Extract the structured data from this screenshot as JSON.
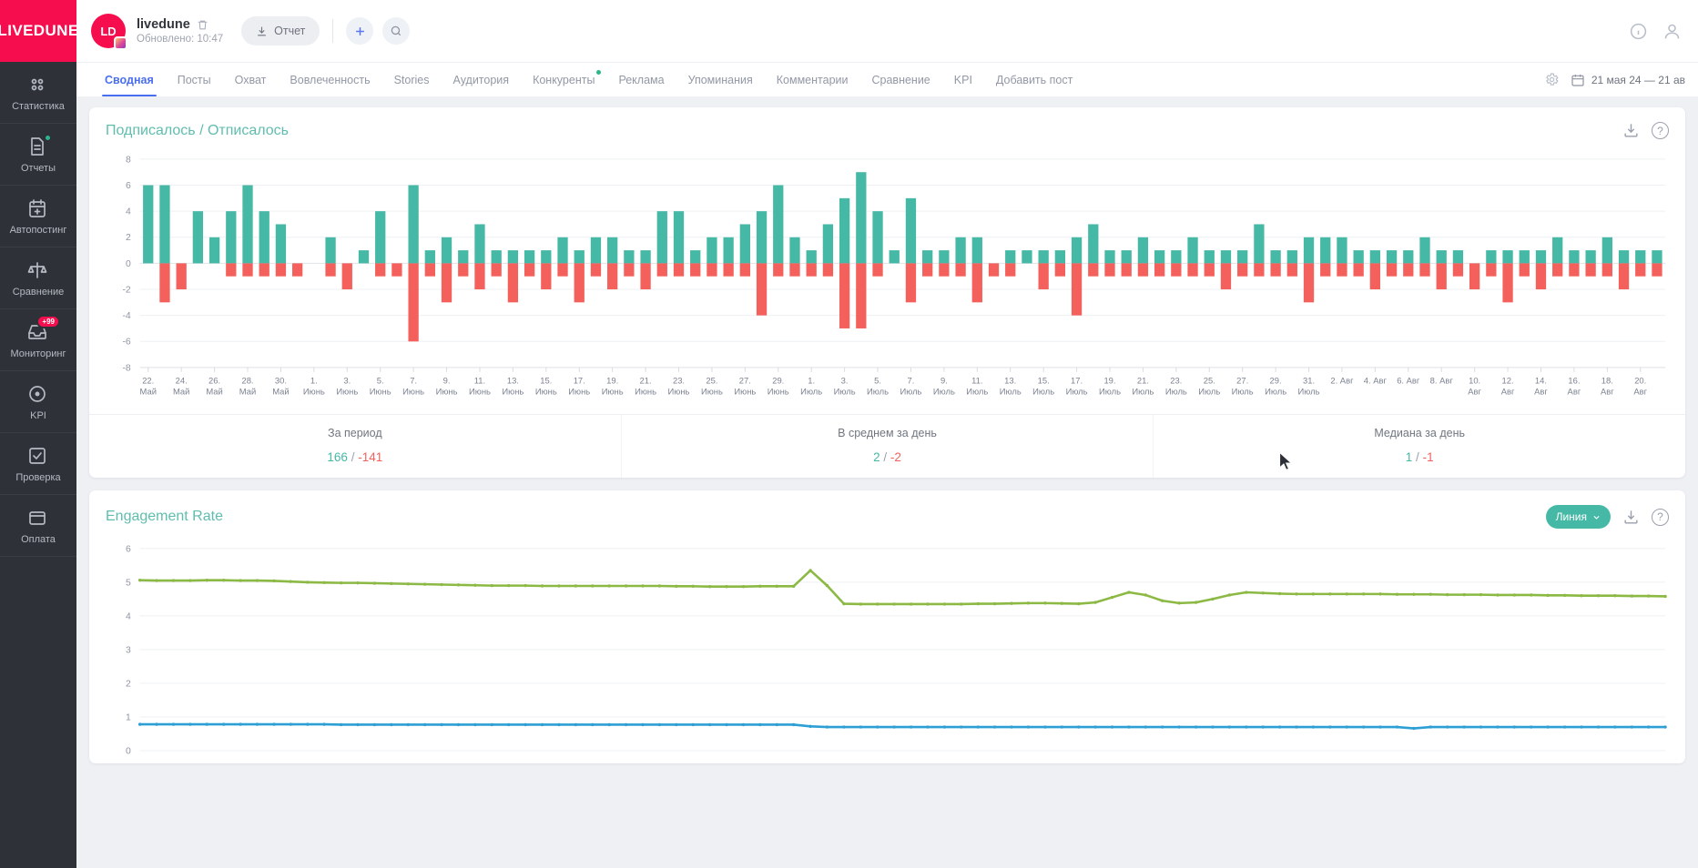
{
  "brand": {
    "logo_text": "LIVEDUNE",
    "logo_color": "#f50d4e"
  },
  "sidebar": {
    "items": [
      {
        "label": "Статистика",
        "icon": "grid-dots-icon",
        "active": false,
        "badge": null
      },
      {
        "label": "Отчеты",
        "icon": "report-doc-icon",
        "active": false,
        "badge": "dot"
      },
      {
        "label": "Автопостинг",
        "icon": "calendar-plus-icon",
        "active": false,
        "badge": null
      },
      {
        "label": "Сравнение",
        "icon": "scales-icon",
        "active": false,
        "badge": null
      },
      {
        "label": "Мониторинг",
        "icon": "inbox-icon",
        "active": false,
        "badge": "+99"
      },
      {
        "label": "KPI",
        "icon": "target-icon",
        "active": false,
        "badge": null
      },
      {
        "label": "Проверка",
        "icon": "checkbox-icon",
        "active": false,
        "badge": null
      },
      {
        "label": "Оплата",
        "icon": "wallet-icon",
        "active": false,
        "badge": null
      }
    ]
  },
  "topbar": {
    "avatar_initials": "LD",
    "account_name": "livedune",
    "updated_text": "Обновлено: 10:47",
    "report_button": "Отчет",
    "add_button_icon": "plus-icon",
    "search_button_icon": "search-icon",
    "trash_icon": "trash-icon",
    "info_icon": "info-circle-icon",
    "profile_icon": "user-icon"
  },
  "tabs": [
    {
      "label": "Сводная",
      "active": true,
      "dot": false
    },
    {
      "label": "Посты",
      "active": false,
      "dot": false
    },
    {
      "label": "Охват",
      "active": false,
      "dot": false
    },
    {
      "label": "Вовлеченность",
      "active": false,
      "dot": false
    },
    {
      "label": "Stories",
      "active": false,
      "dot": false
    },
    {
      "label": "Аудитория",
      "active": false,
      "dot": false
    },
    {
      "label": "Конкуренты",
      "active": false,
      "dot": true
    },
    {
      "label": "Реклама",
      "active": false,
      "dot": false
    },
    {
      "label": "Упоминания",
      "active": false,
      "dot": false
    },
    {
      "label": "Комментарии",
      "active": false,
      "dot": false
    },
    {
      "label": "Сравнение",
      "active": false,
      "dot": false
    },
    {
      "label": "KPI",
      "active": false,
      "dot": false
    },
    {
      "label": "Добавить пост",
      "active": false,
      "dot": false
    }
  ],
  "tabsbar_right": {
    "settings_icon": "gear-icon",
    "calendar_icon": "calendar-icon",
    "date_range": "21 мая 24 — 21 ав"
  },
  "subscribers_card": {
    "title": "Подписалось / Отписалось",
    "download_icon": "download-icon",
    "help_icon": "question-circle-icon",
    "summary": [
      {
        "label": "За период",
        "positive": "166",
        "separator": "/",
        "negative": "-141"
      },
      {
        "label": "В среднем за день",
        "positive": "2",
        "separator": "/",
        "negative": "-2"
      },
      {
        "label": "Медиана за день",
        "positive": "1",
        "separator": "/",
        "negative": "-1"
      }
    ]
  },
  "engagement_card": {
    "title": "Engagement Rate",
    "chart_type_selector": "Линия",
    "chevron_icon": "chevron-down-icon",
    "download_icon": "download-icon",
    "help_icon": "question-circle-icon"
  },
  "chart_data": [
    {
      "type": "bar",
      "title": "Подписалось / Отписалось",
      "xlabel": "",
      "ylabel": "",
      "ylim": [
        -8,
        8
      ],
      "yticks": [
        8,
        6,
        4,
        2,
        0,
        -2,
        -4,
        -6,
        -8
      ],
      "grid": true,
      "legend": "none",
      "colors": {
        "subscribed": "#46b8a6",
        "unsubscribed": "#f4605c"
      },
      "categories": [
        "22. Май",
        "23. Май",
        "24. Май",
        "25. Май",
        "26. Май",
        "27. Май",
        "28. Май",
        "29. Май",
        "30. Май",
        "31. Май",
        "1. Июнь",
        "2. Июнь",
        "3. Июнь",
        "4. Июнь",
        "5. Июнь",
        "6. Июнь",
        "7. Июнь",
        "8. Июнь",
        "9. Июнь",
        "10. Июнь",
        "11. Июнь",
        "12. Июнь",
        "13. Июнь",
        "14. Июнь",
        "15. Июнь",
        "16. Июнь",
        "17. Июнь",
        "18. Июнь",
        "19. Июнь",
        "20. Июнь",
        "21. Июнь",
        "22. Июнь",
        "23. Июнь",
        "24. Июнь",
        "25. Июнь",
        "26. Июнь",
        "27. Июнь",
        "28. Июнь",
        "29. Июнь",
        "30. Июнь",
        "1. Июль",
        "2. Июль",
        "3. Июль",
        "4. Июль",
        "5. Июль",
        "6. Июль",
        "7. Июль",
        "8. Июль",
        "9. Июль",
        "10. Июль",
        "11. Июль",
        "12. Июль",
        "13. Июль",
        "14. Июль",
        "15. Июль",
        "16. Июль",
        "17. Июль",
        "18. Июль",
        "19. Июль",
        "20. Июль",
        "21. Июль",
        "22. Июль",
        "23. Июль",
        "24. Июль",
        "25. Июль",
        "26. Июль",
        "27. Июль",
        "28. Июль",
        "29. Июль",
        "30. Июль",
        "31. Июль",
        "1. Авг",
        "2. Авг",
        "3. Авг",
        "4. Авг",
        "5. Авг",
        "6. Авг",
        "7. Авг",
        "8. Авг",
        "9. Авг",
        "10. Авг",
        "11. Авг",
        "12. Авг",
        "13. Авг",
        "14. Авг",
        "15. Авг",
        "16. Авг",
        "17. Авг",
        "18. Авг",
        "19. Авг",
        "20. Авг",
        "21. Авг"
      ],
      "axis_tick_labels": [
        {
          "index": 0,
          "top": "22.",
          "bottom": "Май"
        },
        {
          "index": 2,
          "top": "24.",
          "bottom": "Май"
        },
        {
          "index": 4,
          "top": "26.",
          "bottom": "Май"
        },
        {
          "index": 6,
          "top": "28.",
          "bottom": "Май"
        },
        {
          "index": 8,
          "top": "30.",
          "bottom": "Май"
        },
        {
          "index": 10,
          "top": "1.",
          "bottom": "Июнь"
        },
        {
          "index": 12,
          "top": "3.",
          "bottom": "Июнь"
        },
        {
          "index": 14,
          "top": "5.",
          "bottom": "Июнь"
        },
        {
          "index": 16,
          "top": "7.",
          "bottom": "Июнь"
        },
        {
          "index": 18,
          "top": "9.",
          "bottom": "Июнь"
        },
        {
          "index": 20,
          "top": "11.",
          "bottom": "Июнь"
        },
        {
          "index": 22,
          "top": "13.",
          "bottom": "Июнь"
        },
        {
          "index": 24,
          "top": "15.",
          "bottom": "Июнь"
        },
        {
          "index": 26,
          "top": "17.",
          "bottom": "Июнь"
        },
        {
          "index": 28,
          "top": "19.",
          "bottom": "Июнь"
        },
        {
          "index": 30,
          "top": "21.",
          "bottom": "Июнь"
        },
        {
          "index": 32,
          "top": "23.",
          "bottom": "Июнь"
        },
        {
          "index": 34,
          "top": "25.",
          "bottom": "Июнь"
        },
        {
          "index": 36,
          "top": "27.",
          "bottom": "Июнь"
        },
        {
          "index": 38,
          "top": "29.",
          "bottom": "Июнь"
        },
        {
          "index": 40,
          "top": "1.",
          "bottom": "Июль"
        },
        {
          "index": 42,
          "top": "3.",
          "bottom": "Июль"
        },
        {
          "index": 44,
          "top": "5.",
          "bottom": "Июль"
        },
        {
          "index": 46,
          "top": "7.",
          "bottom": "Июль"
        },
        {
          "index": 48,
          "top": "9.",
          "bottom": "Июль"
        },
        {
          "index": 50,
          "top": "11.",
          "bottom": "Июль"
        },
        {
          "index": 52,
          "top": "13.",
          "bottom": "Июль"
        },
        {
          "index": 54,
          "top": "15.",
          "bottom": "Июль"
        },
        {
          "index": 56,
          "top": "17.",
          "bottom": "Июль"
        },
        {
          "index": 58,
          "top": "19.",
          "bottom": "Июль"
        },
        {
          "index": 60,
          "top": "21.",
          "bottom": "Июль"
        },
        {
          "index": 62,
          "top": "23.",
          "bottom": "Июль"
        },
        {
          "index": 64,
          "top": "25.",
          "bottom": "Июль"
        },
        {
          "index": 66,
          "top": "27.",
          "bottom": "Июль"
        },
        {
          "index": 68,
          "top": "29.",
          "bottom": "Июль"
        },
        {
          "index": 70,
          "top": "31.",
          "bottom": "Июль"
        },
        {
          "index": 72,
          "top": "2. Авг",
          "bottom": ""
        },
        {
          "index": 74,
          "top": "4. Авг",
          "bottom": ""
        },
        {
          "index": 76,
          "top": "6. Авг",
          "bottom": ""
        },
        {
          "index": 78,
          "top": "8. Авг",
          "bottom": ""
        },
        {
          "index": 80,
          "top": "10.",
          "bottom": "Авг"
        },
        {
          "index": 82,
          "top": "12.",
          "bottom": "Авг"
        },
        {
          "index": 84,
          "top": "14.",
          "bottom": "Авг"
        },
        {
          "index": 86,
          "top": "16.",
          "bottom": "Авг"
        },
        {
          "index": 88,
          "top": "18.",
          "bottom": "Авг"
        },
        {
          "index": 90,
          "top": "20.",
          "bottom": "Авг"
        }
      ],
      "series": [
        {
          "name": "Подписалось",
          "color": "#46b8a6",
          "values": [
            6,
            6,
            0,
            4,
            2,
            4,
            6,
            4,
            3,
            0,
            0,
            2,
            0,
            1,
            4,
            0,
            6,
            1,
            2,
            1,
            3,
            1,
            1,
            1,
            1,
            2,
            1,
            2,
            2,
            1,
            1,
            4,
            4,
            1,
            2,
            2,
            3,
            4,
            6,
            2,
            1,
            3,
            5,
            7,
            4,
            1,
            5,
            1,
            1,
            2,
            2,
            0,
            1,
            1,
            1,
            1,
            2,
            3,
            1,
            1,
            2,
            1,
            1,
            2,
            1,
            1,
            1,
            3,
            1,
            1,
            2,
            2,
            2,
            1,
            1,
            1,
            1,
            2,
            1,
            1,
            0,
            1,
            1,
            1,
            1,
            2,
            1,
            1,
            2,
            1,
            1,
            1
          ]
        },
        {
          "name": "Отписалось",
          "color": "#f4605c",
          "values": [
            0,
            -3,
            -2,
            0,
            0,
            -1,
            -1,
            -1,
            -1,
            -1,
            0,
            -1,
            -2,
            0,
            -1,
            -1,
            -6,
            -1,
            -3,
            -1,
            -2,
            -1,
            -3,
            -1,
            -2,
            -1,
            -3,
            -1,
            -2,
            -1,
            -2,
            -1,
            -1,
            -1,
            -1,
            -1,
            -1,
            -4,
            -1,
            -1,
            -1,
            -1,
            -5,
            -5,
            -1,
            0,
            -3,
            -1,
            -1,
            -1,
            -3,
            -1,
            -1,
            0,
            -2,
            -1,
            -4,
            -1,
            -1,
            -1,
            -1,
            -1,
            -1,
            -1,
            -1,
            -2,
            -1,
            -1,
            -1,
            -1,
            -3,
            -1,
            -1,
            -1,
            -2,
            -1,
            -1,
            -1,
            -2,
            -1,
            -2,
            -1,
            -3,
            -1,
            -2,
            -1,
            -1,
            -1,
            -1,
            -2,
            -1,
            -1
          ]
        }
      ]
    },
    {
      "type": "line",
      "title": "Engagement Rate",
      "xlabel": "",
      "ylabel": "",
      "ylim": [
        0,
        6
      ],
      "yticks": [
        6,
        5,
        4,
        3,
        2,
        1,
        0
      ],
      "grid": true,
      "legend": "none",
      "series": [
        {
          "name": "ER (green)",
          "color": "#8cb944",
          "values": [
            5.06,
            5.05,
            5.05,
            5.05,
            5.06,
            5.06,
            5.05,
            5.05,
            5.04,
            5.02,
            5.0,
            4.99,
            4.98,
            4.98,
            4.97,
            4.96,
            4.95,
            4.94,
            4.93,
            4.92,
            4.91,
            4.9,
            4.9,
            4.9,
            4.89,
            4.89,
            4.89,
            4.89,
            4.89,
            4.89,
            4.89,
            4.89,
            4.88,
            4.88,
            4.87,
            4.87,
            4.87,
            4.88,
            4.88,
            4.88,
            5.35,
            4.9,
            4.36,
            4.35,
            4.35,
            4.35,
            4.35,
            4.35,
            4.35,
            4.35,
            4.36,
            4.36,
            4.37,
            4.38,
            4.38,
            4.37,
            4.36,
            4.4,
            4.55,
            4.7,
            4.62,
            4.45,
            4.38,
            4.4,
            4.5,
            4.62,
            4.7,
            4.68,
            4.66,
            4.65,
            4.65,
            4.65,
            4.65,
            4.65,
            4.65,
            4.64,
            4.64,
            4.64,
            4.63,
            4.63,
            4.63,
            4.62,
            4.62,
            4.62,
            4.61,
            4.61,
            4.6,
            4.6,
            4.6,
            4.59,
            4.59,
            4.58
          ]
        },
        {
          "name": "ER (blue)",
          "color": "#2e9fd4",
          "values": [
            0.78,
            0.78,
            0.78,
            0.78,
            0.78,
            0.78,
            0.78,
            0.78,
            0.78,
            0.78,
            0.78,
            0.78,
            0.77,
            0.77,
            0.77,
            0.77,
            0.77,
            0.77,
            0.77,
            0.77,
            0.77,
            0.77,
            0.77,
            0.77,
            0.77,
            0.77,
            0.77,
            0.77,
            0.77,
            0.77,
            0.77,
            0.77,
            0.77,
            0.77,
            0.77,
            0.77,
            0.77,
            0.77,
            0.77,
            0.77,
            0.72,
            0.7,
            0.7,
            0.7,
            0.7,
            0.7,
            0.7,
            0.7,
            0.7,
            0.7,
            0.7,
            0.7,
            0.7,
            0.7,
            0.7,
            0.7,
            0.7,
            0.7,
            0.7,
            0.7,
            0.7,
            0.7,
            0.7,
            0.7,
            0.7,
            0.7,
            0.7,
            0.7,
            0.7,
            0.7,
            0.7,
            0.7,
            0.7,
            0.7,
            0.7,
            0.7,
            0.66,
            0.7,
            0.7,
            0.7,
            0.7,
            0.7,
            0.7,
            0.7,
            0.7,
            0.7,
            0.7,
            0.7,
            0.7,
            0.7,
            0.7,
            0.7
          ]
        }
      ]
    }
  ]
}
